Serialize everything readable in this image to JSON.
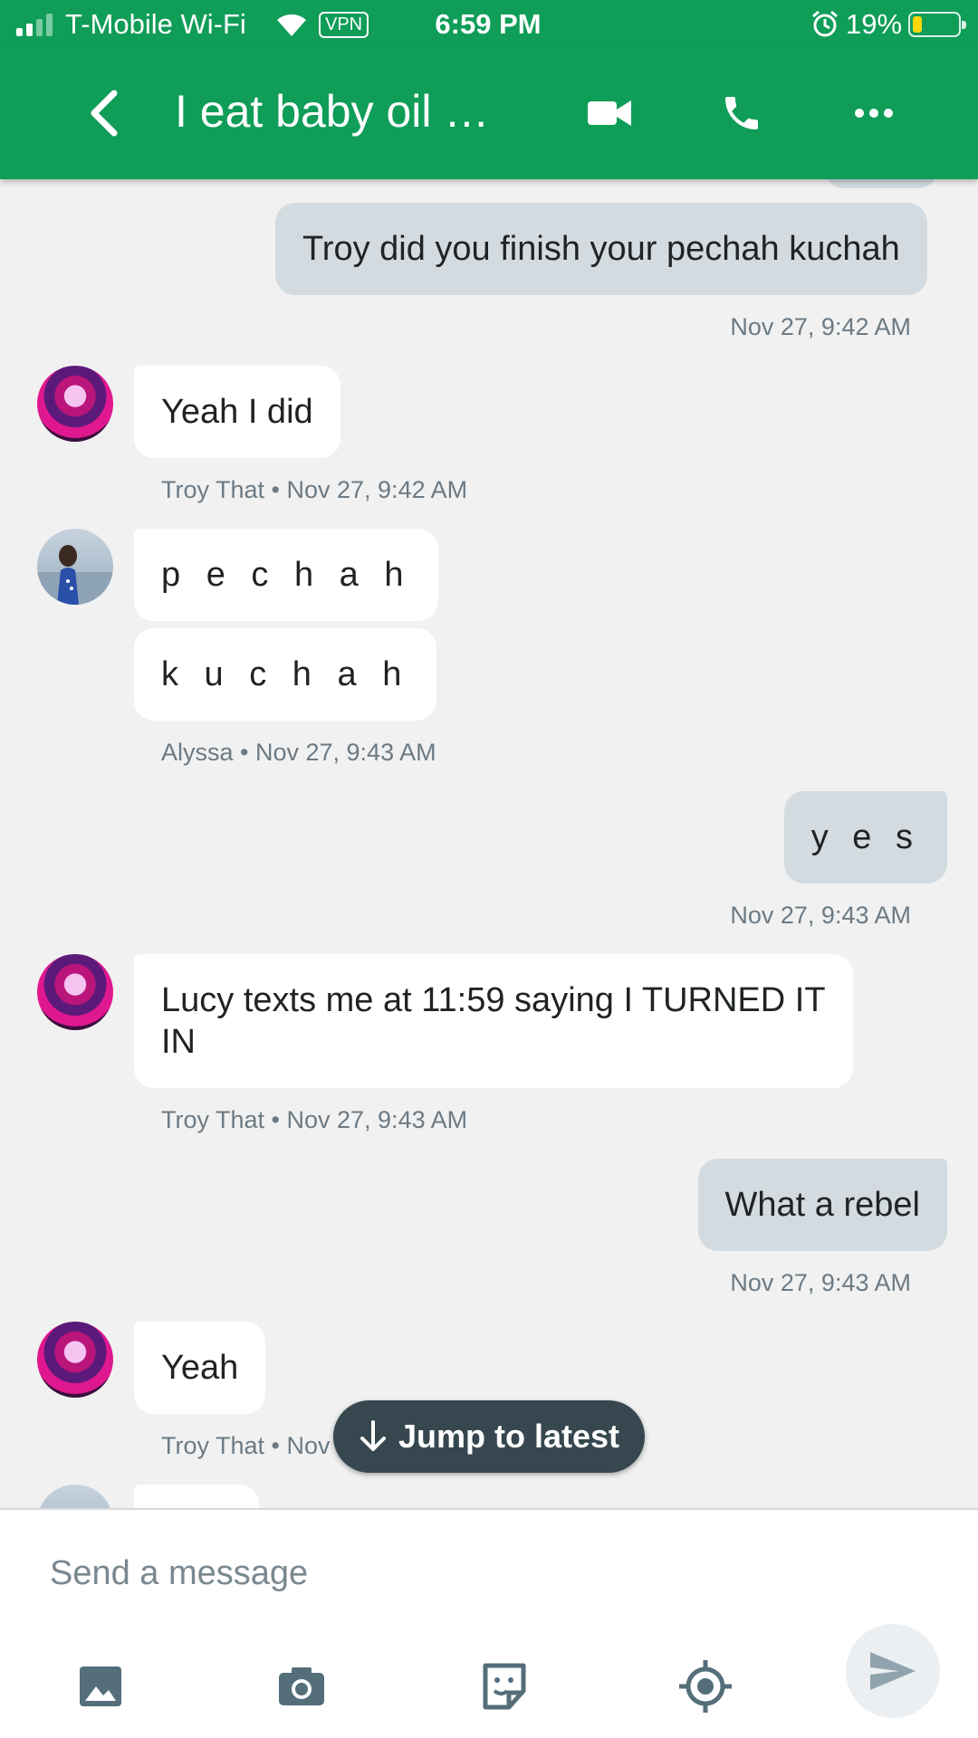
{
  "status_bar": {
    "carrier": "T-Mobile Wi-Fi",
    "vpn": "VPN",
    "time": "6:59 PM",
    "battery": "19%",
    "battery_level": 0.19,
    "signal_icon": "cellular-signal-icon",
    "wifi_icon": "wifi-icon",
    "alarm_icon": "alarm-clock-icon"
  },
  "header": {
    "title": "I eat baby oil 👶…",
    "back_icon": "chevron-left-icon",
    "video_icon": "video-camera-icon",
    "call_icon": "phone-icon",
    "more_icon": "more-horizontal-icon",
    "bg_color": "#0f9d58"
  },
  "messages": [
    {
      "sender": "me",
      "text": "Troy did you finish your pechah kuchah",
      "meta": "Nov 27, 9:42 AM"
    },
    {
      "sender": "Troy That",
      "text": "Yeah I did",
      "meta": "Troy That • Nov 27, 9:42 AM"
    },
    {
      "sender": "Alyssa",
      "text": "p e c h a h",
      "text2": "k u c h a h",
      "meta": "Alyssa • Nov 27, 9:43 AM"
    },
    {
      "sender": "me",
      "text": "y e s",
      "meta": "Nov 27, 9:43 AM"
    },
    {
      "sender": "Troy That",
      "text_line1": "Lucy texts me at 11:59 saying I TURNED IT",
      "text_line2": "IN",
      "meta": "Troy That • Nov 27, 9:43 AM"
    },
    {
      "sender": "me",
      "text": "What a rebel",
      "meta": "Nov 27, 9:43 AM"
    },
    {
      "sender": "Troy That",
      "text": "Yeah",
      "meta": "Troy That • Nov 2"
    }
  ],
  "jump_button": {
    "label": "Jump to latest",
    "icon": "arrow-down-icon"
  },
  "compose": {
    "placeholder": "Send a message",
    "gallery_icon": "image-icon",
    "camera_icon": "camera-icon",
    "sticker_icon": "sticker-icon",
    "location_icon": "location-target-icon",
    "send_icon": "send-icon"
  }
}
